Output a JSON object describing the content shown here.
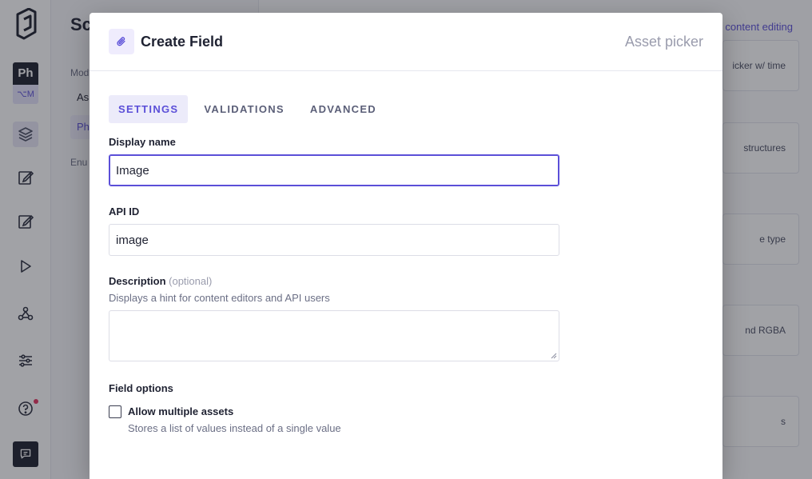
{
  "sidebar": {
    "project_badge": "Ph",
    "env_badge": "⌥M",
    "items": [
      {
        "icon": "layers-icon"
      },
      {
        "icon": "edit-icon"
      },
      {
        "icon": "edit-icon"
      },
      {
        "icon": "play-icon"
      },
      {
        "icon": "webhook-icon"
      },
      {
        "icon": "sliders-icon"
      },
      {
        "icon": "help-icon"
      },
      {
        "icon": "chat-icon"
      }
    ]
  },
  "schema_panel": {
    "title": "Sc",
    "section_models": "Mod",
    "item_1": "As",
    "item_2": "Ph",
    "section_enums": "Enu"
  },
  "main": {
    "top_link": "content editing",
    "cards": [
      "icker w/ time",
      "structures",
      "e type",
      "nd RGBA",
      "s"
    ]
  },
  "modal": {
    "title": "Create Field",
    "field_type": "Asset picker",
    "tabs": [
      {
        "label": "SETTINGS",
        "active": true
      },
      {
        "label": "VALIDATIONS",
        "active": false
      },
      {
        "label": "ADVANCED",
        "active": false
      }
    ],
    "display_name": {
      "label": "Display name",
      "value": "Image"
    },
    "api_id": {
      "label": "API ID",
      "value": "image"
    },
    "description": {
      "label": "Description",
      "optional": "(optional)",
      "hint": "Displays a hint for content editors and API users",
      "value": ""
    },
    "field_options": {
      "label": "Field options",
      "allow_multiple": {
        "label": "Allow multiple assets",
        "hint": "Stores a list of values instead of a single value",
        "checked": false
      }
    }
  },
  "colors": {
    "accent": "#5b4fd8",
    "accent_bg": "#ecebfa",
    "dark": "#1c1f2e"
  }
}
